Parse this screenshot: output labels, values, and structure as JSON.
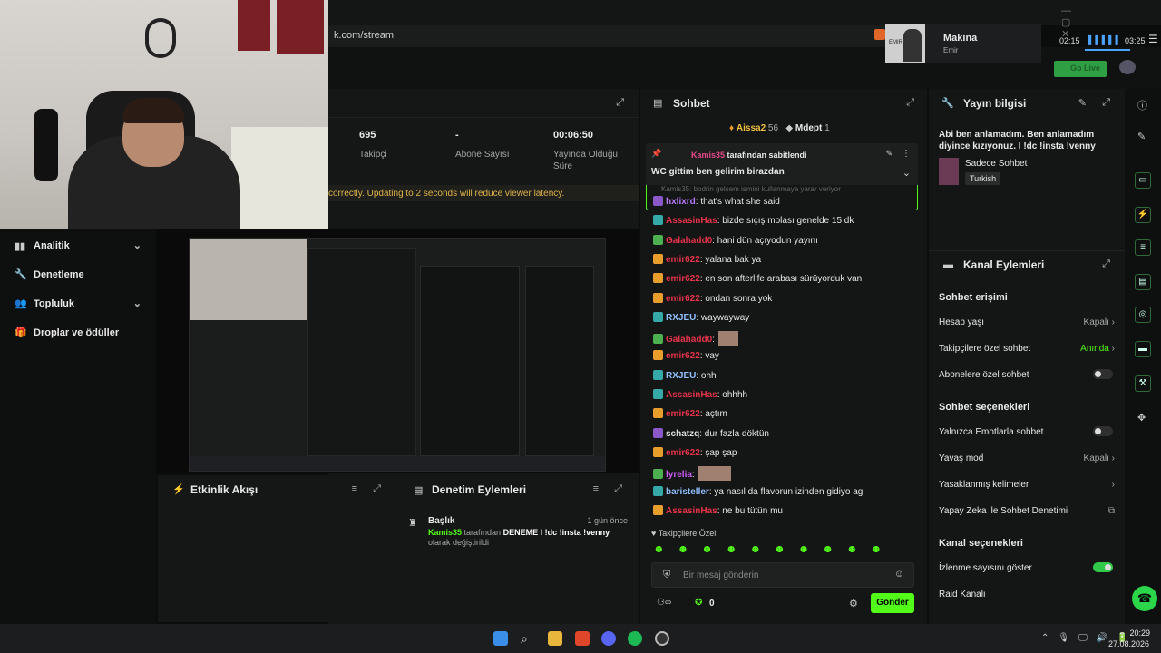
{
  "browser": {
    "url": "k.com/stream"
  },
  "music": {
    "title": "Makina",
    "artist": "Emir",
    "album_text": "EMIR",
    "elapsed": "02:15",
    "total": "03:25"
  },
  "header": {
    "go_live": "Go Live"
  },
  "stats": {
    "items": [
      {
        "value": "695",
        "label": "Takipçi"
      },
      {
        "value": "-",
        "label": "Abone Sayısı"
      },
      {
        "value": "00:06:50",
        "label": "Yayında Olduğu Süre"
      }
    ],
    "notice": "correctly. Updating to 2 seconds will reduce viewer latency."
  },
  "sidebar": {
    "items": [
      {
        "label": "Analitik",
        "icon": "chart-icon"
      },
      {
        "label": "Denetleme",
        "icon": "wrench-icon"
      },
      {
        "label": "Topluluk",
        "icon": "people-icon"
      },
      {
        "label": "Droplar ve ödüller",
        "icon": "gift-icon"
      }
    ]
  },
  "events": {
    "title": "Etkinlik Akışı"
  },
  "moderation": {
    "title": "Denetim Eylemleri",
    "entry": {
      "heading": "Başlık",
      "time": "1 gün önce",
      "user": "Kamis35",
      "mid": " tarafından ",
      "title_text": "DENEME I !dc !insta !venny",
      "suffix": " olarak değiştirildi"
    }
  },
  "chat": {
    "title": "Sohbet",
    "top_users": [
      {
        "name": "Aissa2",
        "count": "56"
      },
      {
        "name": "Mdept",
        "count": "1"
      }
    ],
    "pinned": {
      "by": "Kamis35",
      "by_suffix": " tarafından sabitlendi",
      "text": "WC gittim ben gelirim birazdan"
    },
    "overlap": "Kamis35: bodrin gelsem ismini kullanmaya yarar veriyor",
    "messages": [
      {
        "user": "hxlixrd",
        "color": "#b77bff",
        "text": ": that's what she said"
      },
      {
        "user": "AssasinHas",
        "color": "#e8344a",
        "text": ": bizde sıçış molası genelde 15 dk"
      },
      {
        "user": "Galahadd0",
        "color": "#e8344a",
        "text": ": hani dün açıyodun yayını"
      },
      {
        "user": "emir622",
        "color": "#e8344a",
        "text": ": yalana bak ya"
      },
      {
        "user": "emir622",
        "color": "#e8344a",
        "text": ": en son afterlife arabası sürüyorduk van"
      },
      {
        "user": "emir622",
        "color": "#e8344a",
        "text": ": ondan sonra yok"
      },
      {
        "user": "RXJEU",
        "color": "#8fc1ff",
        "text": ": waywayway"
      },
      {
        "user": "Galahadd0",
        "color": "#e8344a",
        "text": ":"
      },
      {
        "user": "emir622",
        "color": "#e8344a",
        "text": ": vay"
      },
      {
        "user": "RXJEU",
        "color": "#8fc1ff",
        "text": ": ohh"
      },
      {
        "user": "AssasinHas",
        "color": "#e8344a",
        "text": ": ohhhh"
      },
      {
        "user": "emir622",
        "color": "#e8344a",
        "text": ": açtım"
      },
      {
        "user": "schatzq",
        "color": "#e0e0e0",
        "text": ": dur fazla döktün"
      },
      {
        "user": "emir622",
        "color": "#e8344a",
        "text": ": şap şap"
      },
      {
        "user": "lyrelia",
        "color": "#d15cff",
        "text": ":"
      },
      {
        "user": "baristeller",
        "color": "#8fc1ff",
        "text": ": ya nasıl da flavorun izinden gidiyo ag"
      },
      {
        "user": "AssasinHas",
        "color": "#e8344a",
        "text": ": ne bu tütün mu"
      }
    ],
    "followers_only": "Takipçilere Özel",
    "input_placeholder": "Bir mesaj gönderin",
    "points": "0",
    "send": "Gönder"
  },
  "stream_info": {
    "title": "Yayın bilgisi",
    "stream_title": "Abi ben anlamadım. Ben anlamadım diyince kızıyonuz. I !dc !insta !venny",
    "category": "Sadece Sohbet",
    "tag": "Turkish"
  },
  "channel_actions": {
    "title": "Kanal Eylemleri",
    "chat_access": "Sohbet erişimi",
    "account_age": {
      "label": "Hesap yaşı",
      "value": "Kapalı"
    },
    "followers_chat": {
      "label": "Takipçilere özel sohbet",
      "value": "Anında"
    },
    "subs_chat": {
      "label": "Abonelere özel sohbet"
    },
    "chat_options": "Sohbet seçenekleri",
    "emote_only": {
      "label": "Yalnızca Emotlarla sohbet"
    },
    "slow_mode": {
      "label": "Yavaş mod",
      "value": "Kapalı"
    },
    "banned_words": {
      "label": "Yasaklanmış kelimeler"
    },
    "ai_mod": {
      "label": "Yapay Zeka ile Sohbet Denetimi"
    },
    "channel_options": "Kanal seçenekleri",
    "show_viewers": {
      "label": "İzlenme sayısını göster"
    },
    "raid": {
      "label": "Raid Kanalı"
    }
  },
  "taskbar": {
    "time": "20:29",
    "date": "27.08.2026"
  }
}
